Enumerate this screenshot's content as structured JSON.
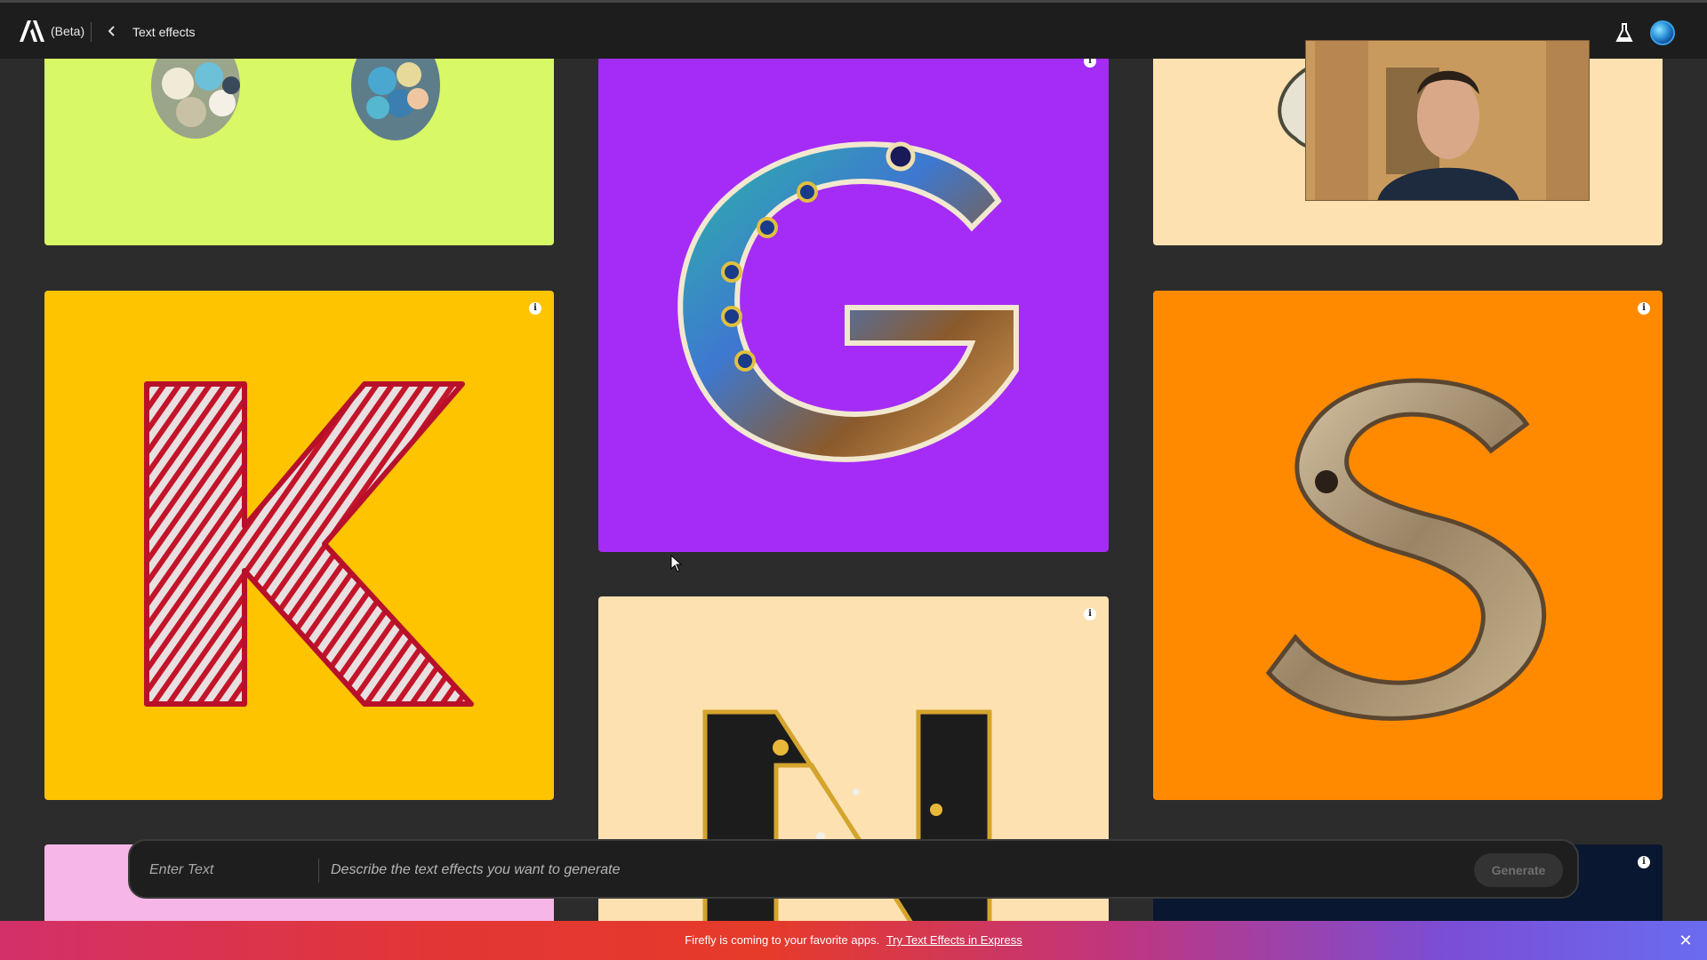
{
  "header": {
    "beta_label": "(Beta)",
    "page_title": "Text effects",
    "logo_icon": "adobe-logo",
    "back_icon": "chevron-left-icon",
    "lab_icon": "flask-icon"
  },
  "gallery": {
    "cards": [
      {
        "letter": "",
        "bg": "#d8f865",
        "effect": "beads"
      },
      {
        "letter": "G",
        "bg": "#a52cf7",
        "effect": "peacock feathers"
      },
      {
        "letter": "",
        "bg": "#fde1b1",
        "effect": "ribbon"
      },
      {
        "letter": "K",
        "bg": "#ffc400",
        "effect": "red fur"
      },
      {
        "letter": "S",
        "bg": "#ff8a00",
        "effect": "driftwood"
      },
      {
        "letter": "N",
        "bg": "#fde1b1",
        "effect": "black paint gold drips"
      },
      {
        "letter": "",
        "bg": "#f6b7e6",
        "effect": ""
      },
      {
        "letter": "",
        "bg": "#0a1730",
        "effect": ""
      }
    ]
  },
  "prompt": {
    "text_placeholder": "Enter Text",
    "description_placeholder": "Describe the text effects you want to generate",
    "generate_label": "Generate"
  },
  "banner": {
    "message": "Firefly is coming to your favorite apps.",
    "link_text": "Try Text Effects in Express",
    "close_icon": "close-icon"
  },
  "colors": {
    "topbar_bg": "#1d1d1d",
    "page_bg": "#2c2c2c",
    "accent": "#a52cf7"
  }
}
